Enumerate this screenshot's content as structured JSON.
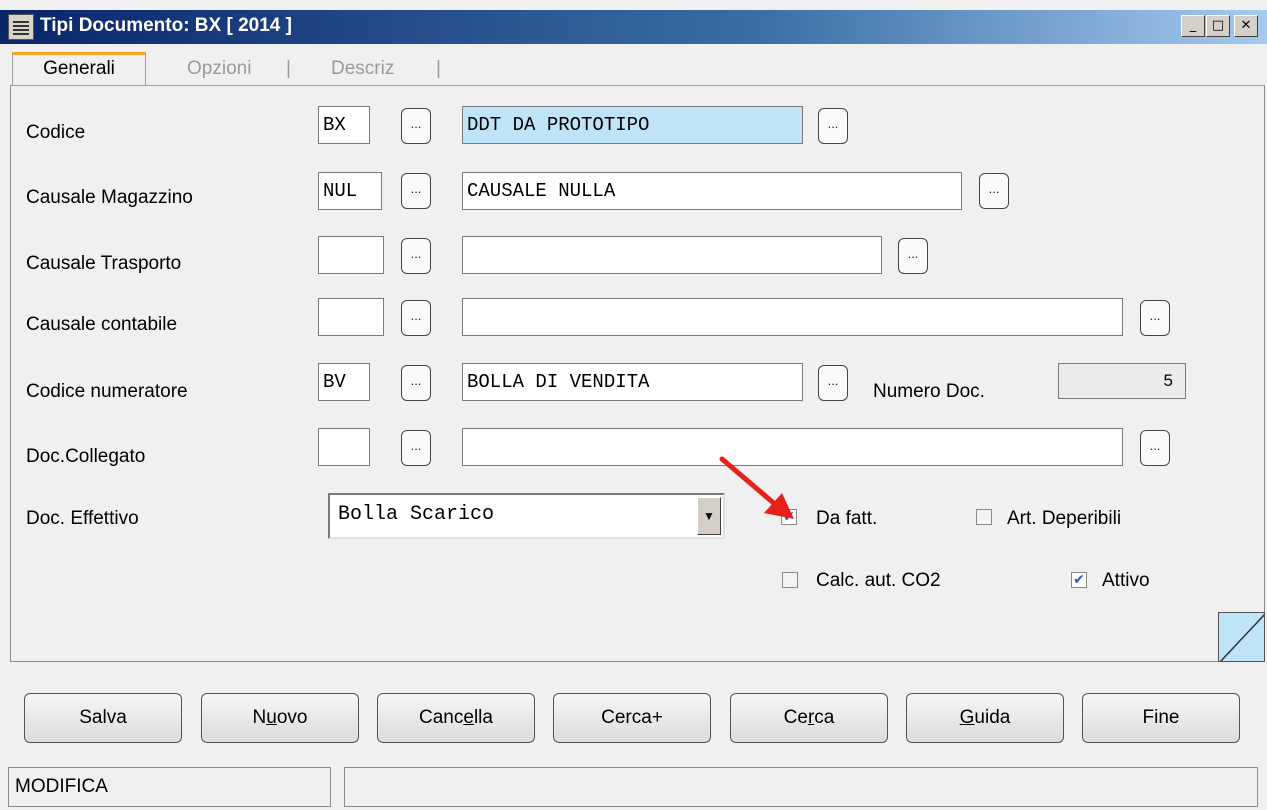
{
  "window": {
    "title": "Tipi Documento: BX [ 2014 ]",
    "controls": {
      "minimize": "_",
      "maximize": "□",
      "close": "✕"
    }
  },
  "tabs": [
    {
      "label": "Generali",
      "active": true
    },
    {
      "label": "Opzioni",
      "active": false
    },
    {
      "label": "Descriz",
      "active": false
    }
  ],
  "tab_separator": "|",
  "lookup_button_label": "...",
  "form": {
    "codice": {
      "label": "Codice",
      "code": "BX",
      "description": "DDT DA PROTOTIPO"
    },
    "causale_magazzino": {
      "label": "Causale Magazzino",
      "code": "NUL",
      "description": "CAUSALE NULLA"
    },
    "causale_trasporto": {
      "label": "Causale Trasporto",
      "code": "",
      "description": ""
    },
    "causale_contabile": {
      "label": "Causale contabile",
      "code": "",
      "description": ""
    },
    "codice_numeratore": {
      "label": "Codice numeratore",
      "code": "BV",
      "description": "BOLLA DI VENDITA"
    },
    "numero_doc": {
      "label": "Numero Doc.",
      "value": "5"
    },
    "doc_collegato": {
      "label": "Doc.Collegato",
      "code": "",
      "description": ""
    },
    "doc_effettivo": {
      "label": "Doc. Effettivo",
      "selected": "Bolla Scarico"
    }
  },
  "checkboxes": {
    "da_fatt": {
      "label": "Da fatt.",
      "checked": true
    },
    "art_deperibili": {
      "label": "Art. Deperibili",
      "checked": false
    },
    "calc_co2": {
      "label": "Calc. aut. CO2",
      "checked": false
    },
    "attivo": {
      "label": "Attivo",
      "checked": true
    }
  },
  "buttons": {
    "salva": {
      "pre": "Salva",
      "ul": "",
      "post": ""
    },
    "nuovo": {
      "pre": "N",
      "ul": "u",
      "post": "ovo"
    },
    "cancella": {
      "pre": "Canc",
      "ul": "e",
      "post": "lla"
    },
    "cerca_plus": {
      "pre": "Cerca+",
      "ul": "",
      "post": ""
    },
    "cerca": {
      "pre": "Ce",
      "ul": "r",
      "post": "ca"
    },
    "guida": {
      "pre": "",
      "ul": "G",
      "post": "uida"
    },
    "fine": {
      "pre": "Fine",
      "ul": "",
      "post": ""
    }
  },
  "status": {
    "mode": "MODIFICA",
    "message": ""
  },
  "colors": {
    "selected_field": "#bfe3f7",
    "tab_accent": "#f5a623",
    "check_mark": "#2b57b8",
    "annotation_arrow": "#e8201a"
  },
  "icons": {
    "checkmark": "✔",
    "dropdown": "▼"
  }
}
